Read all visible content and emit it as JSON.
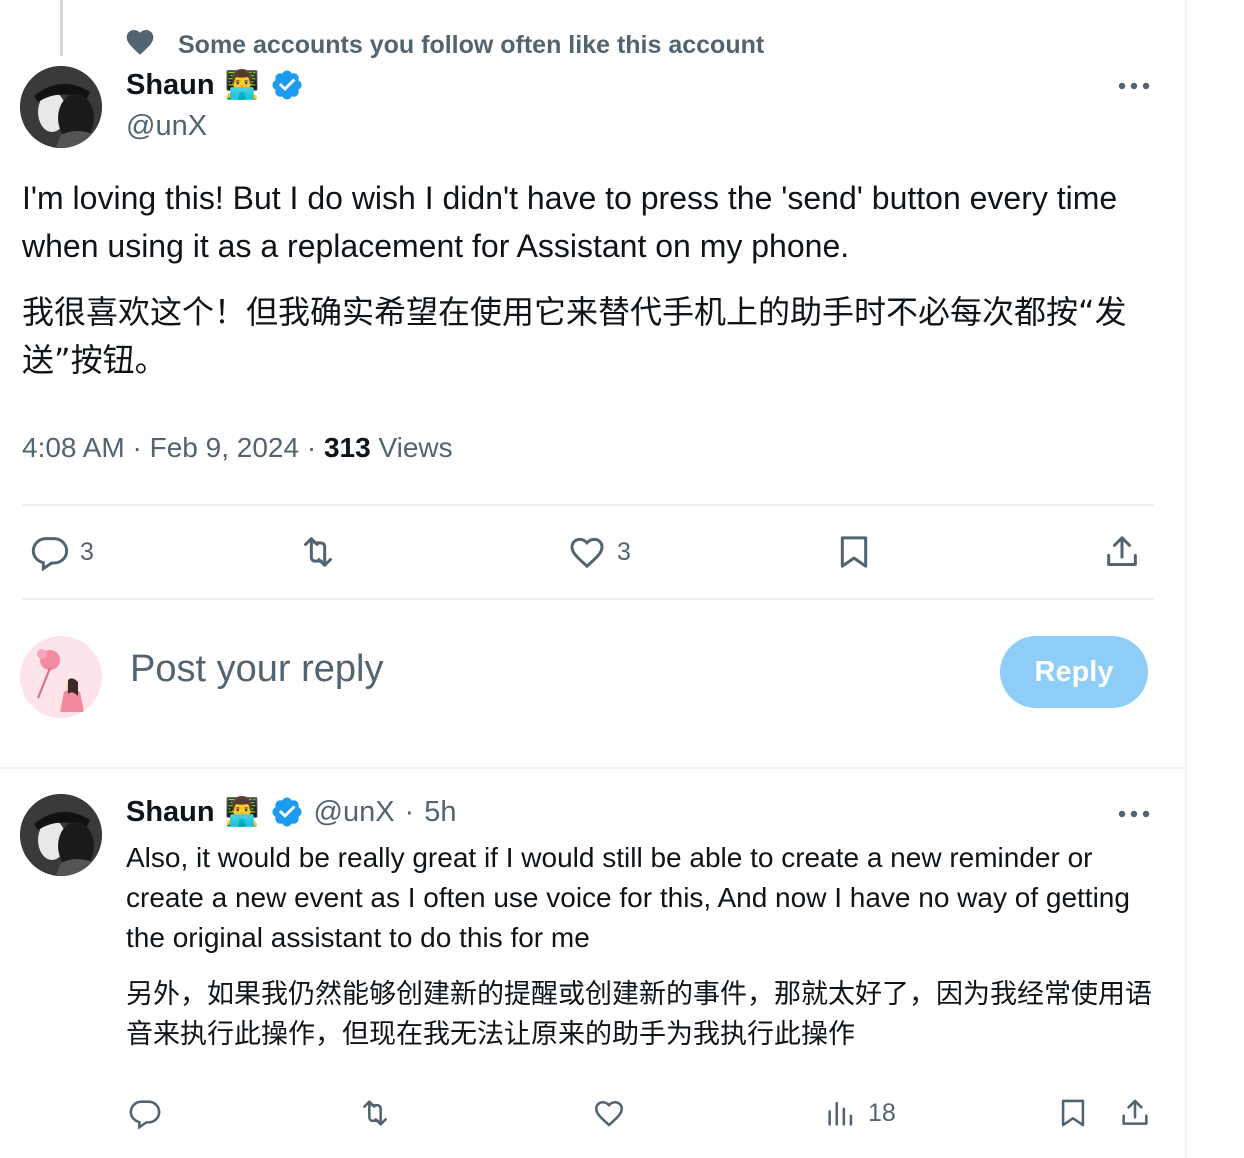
{
  "social_context": "Some accounts you follow often like this account",
  "main_tweet": {
    "author_name": "Shaun",
    "author_emoji": "👨‍💻",
    "handle": "@unX",
    "text_en": "I'm loving this! But I do wish I didn't have to press the 'send' button every time when using it as a replacement for Assistant on my phone.",
    "text_cn": "我很喜欢这个！但我确实希望在使用它来替代手机上的助手时不必每次都按“发送”按钮。",
    "time": "4:08 AM",
    "date": "Feb 9, 2024",
    "views_count": "313",
    "views_label": "Views",
    "replies": "3",
    "likes": "3"
  },
  "reply_composer": {
    "placeholder": "Post your reply",
    "button_label": "Reply"
  },
  "reply_tweet": {
    "author_name": "Shaun",
    "author_emoji": "👨‍💻",
    "handle": "@unX",
    "age": "5h",
    "text_en": "Also, it would be really great if I would still be able to create a new reminder or create a new event as I often use voice for this, And now I have no way of getting the original assistant to do this for me",
    "text_cn": "另外，如果我仍然能够创建新的提醒或创建新的事件，那就太好了，因为我经常使用语音来执行此操作，但现在我无法让原来的助手为我执行此操作",
    "views": "18"
  },
  "colors": {
    "accent": "#1d9bf0",
    "reply_button_disabled": "#8ecdf8",
    "secondary_text": "#536471"
  },
  "icons": [
    "heart-icon",
    "verified-badge-icon",
    "more-icon",
    "reply-icon",
    "retweet-icon",
    "like-icon",
    "bookmark-icon",
    "share-icon",
    "views-icon"
  ]
}
